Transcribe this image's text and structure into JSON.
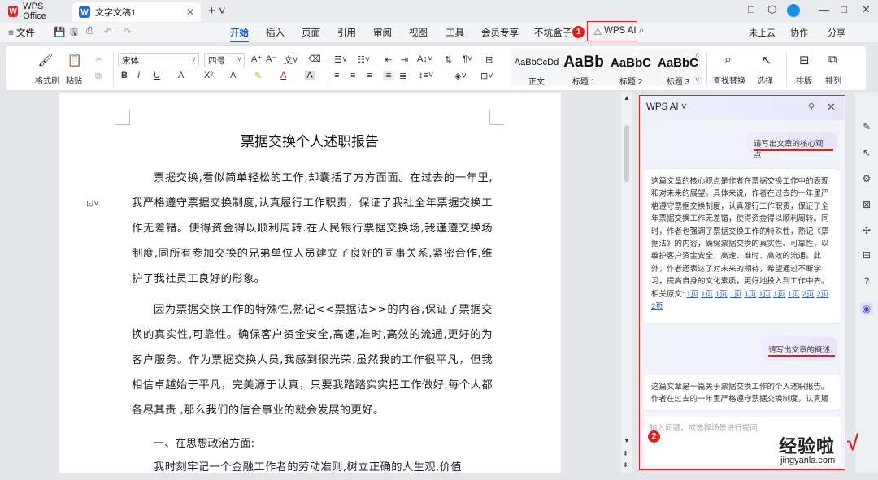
{
  "titlebar": {
    "tabs": [
      {
        "label": "WPS Office",
        "logo": "W"
      },
      {
        "label": "文字文稿1",
        "logo": "W"
      }
    ],
    "close": "✕",
    "new_tab": "+ ˅",
    "controls": [
      "□",
      "⬡",
      "—",
      "□",
      "✕"
    ]
  },
  "menubar": {
    "file": "≡ 文件",
    "quick": [
      "💾",
      "🖫",
      "⎙",
      "↶",
      "↷"
    ],
    "tabs": [
      "开始",
      "插入",
      "页面",
      "引用",
      "审阅",
      "视图",
      "工具",
      "会员专享",
      "不坑盒子",
      "WPS AI"
    ],
    "active": "开始",
    "right": [
      "未上云",
      "协作",
      "分享"
    ]
  },
  "annotations": {
    "badge1": "1",
    "badge2": "2"
  },
  "toolbar": {
    "format_painter": "格式刷",
    "paste": "粘贴",
    "font": "宋体",
    "size": "四号",
    "font_row2": [
      "B",
      "I",
      "U",
      "A",
      "X²",
      "A",
      "A"
    ],
    "styles": [
      {
        "preview": "AaBbCcDd",
        "label": "正文"
      },
      {
        "preview": "AaBb",
        "label": "标题 1"
      },
      {
        "preview": "AaBbC",
        "label": "标题 2"
      },
      {
        "preview": "AaBbC",
        "label": "标题 3"
      }
    ],
    "find_replace": "查找替换",
    "select": "选择",
    "arrange": "排版",
    "sort": "排列"
  },
  "document": {
    "title": "票据交换个人述职报告",
    "p1": "票据交换,看似简单轻松的工作,却囊括了方方面面。在过去的一年里,我严格遵守票据交换制度,认真履行工作职责，保证了我社全年票据交换工作无差错。使得资金得以顺利周转.在人民银行票据交换场,我谨遵交换场制度,同所有参加交换的兄弟单位人员建立了良好的同事关系,紧密合作,维护了我社员工良好的形象。",
    "p2": "因为票据交换工作的特殊性,熟记<<票据法>>的内容,保证了票据交换的真实性,可靠性。确保客户资金安全,高速,准时,高效的流通,更好的为客户服务。作为票据交换人员,我感到很光荣,虽然我的工作很平凡，但我相信卓越始于平凡，完美源于认真，只要我踏踏实实把工作做好,每个人都各尽其责 ,那么我们的信合事业的就会发展的更好。",
    "h2": "一、在思想政治方面:",
    "p3": "我时刻牢记一个金融工作者的劳动准则,树立正确的人生观,价值"
  },
  "ai_panel": {
    "title": "WPS AI ˅",
    "q1": "请写出文章的核心观点",
    "a1": "这篇文章的核心观点是作者在票据交换工作中的表现和对未来的展望。具体来说，作者在过去的一年里严格遵守票据交换制度，认真履行工作职责，保证了全年票据交换工作无差错，使得资金得以顺利周转。同时，作者也强调了票据交换工作的特殊性，熟记《票据法》的内容，确保票据交换的真实性、可靠性，以维护客户资金安全，高速、准时、高效的流通。此外，作者还表达了对未来的期待，希望通过不断学习，提高自身的文化素质，更好地投入到工作中去。",
    "source_label": "相关原文:",
    "source_links": [
      "1页",
      "1页",
      "1页",
      "1页",
      "1页",
      "1页",
      "1页",
      "1页",
      "2页",
      "2页",
      "2页"
    ],
    "q2": "请写出文章的概述",
    "a2": "这篇文章是一篇关于票据交换工作的个人述职报告。作者在过去的一年里严格遵守票据交换制度，认真履",
    "input_placeholder": "输入问题，或选择场景进行提问"
  },
  "watermark": {
    "main": "经验啦",
    "sub": "jingyanla.com",
    "check": "√"
  }
}
